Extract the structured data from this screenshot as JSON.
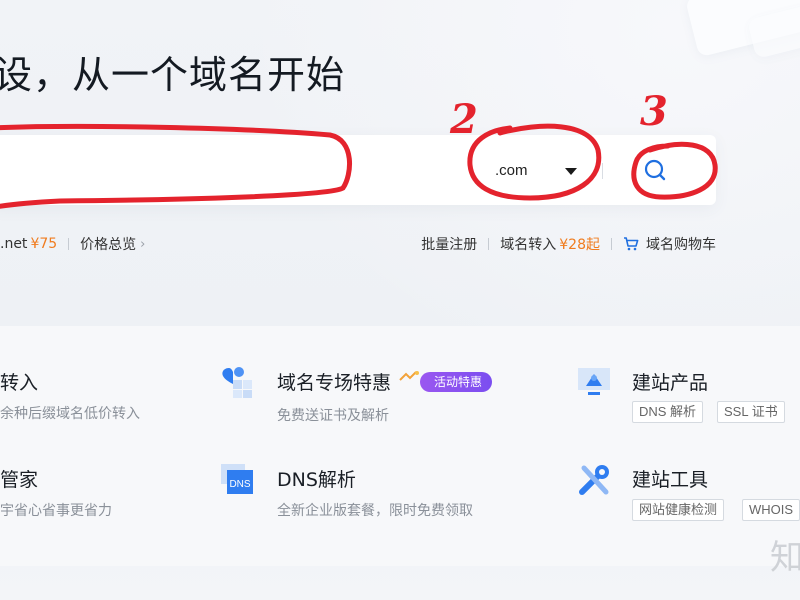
{
  "hero": {
    "title": "设，从一个域名开始"
  },
  "search": {
    "placeholder": "",
    "tld_selected": ".com"
  },
  "annotations": [
    "2",
    "3"
  ],
  "sub_links_left": {
    "net_label": ".net",
    "net_price": "¥75",
    "price_overview": "价格总览"
  },
  "sub_links_right": {
    "bulk_register": "批量注册",
    "transfer": "域名转入",
    "transfer_price": "¥28起",
    "cart": "域名购物车"
  },
  "services": {
    "col1": [
      {
        "title": "转入",
        "desc": "余种后缀域名低价转入"
      },
      {
        "title": "管家",
        "desc": "宇省心省事更省力"
      }
    ],
    "col2": [
      {
        "title": "域名专场特惠",
        "badge": "活动特惠",
        "desc": "免费送证书及解析",
        "icon": "heart-grid-icon"
      },
      {
        "title": "DNS解析",
        "desc": "全新企业版套餐，限时免费领取",
        "icon": "dns-icon"
      }
    ],
    "col3": [
      {
        "title": "建站产品",
        "tags": [
          "DNS 解析",
          "SSL 证书"
        ],
        "icon": "monitor-icon"
      },
      {
        "title": "建站工具",
        "tags": [
          "网站健康检测",
          "WHOIS"
        ],
        "icon": "tools-icon"
      }
    ]
  },
  "watermark": "知",
  "colors": {
    "accent_blue": "#1f6fe0",
    "price_orange": "#f07c1f",
    "annotation_red": "#e4232d",
    "badge_purple": "#8a52f0"
  }
}
